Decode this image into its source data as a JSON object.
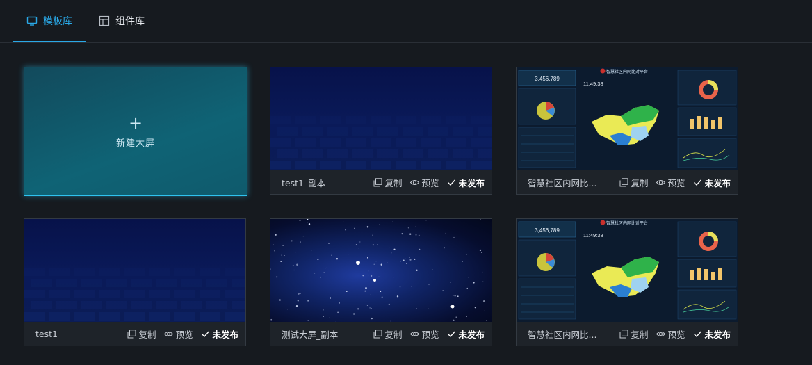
{
  "tabs": [
    {
      "label": "模板库",
      "active": true,
      "icon": "monitor-icon"
    },
    {
      "label": "组件库",
      "active": false,
      "icon": "layout-icon"
    }
  ],
  "new_card": {
    "plus": "+",
    "label": "新建大屏"
  },
  "actions": {
    "copy": "复制",
    "preview": "预览",
    "status": "未发布"
  },
  "cards": [
    {
      "name": "test1_副本",
      "thumb": "blue-grid"
    },
    {
      "name": "智慧社区内网比...",
      "thumb": "dashboard"
    },
    {
      "name": "test1",
      "thumb": "blue-grid"
    },
    {
      "name": "测试大屏_副本",
      "thumb": "starfield"
    },
    {
      "name": "智慧社区内网比...",
      "thumb": "dashboard"
    }
  ],
  "dashboard_thumb": {
    "title": "智慧社区内网比对平台",
    "big_number": "3,456,789",
    "clock": "11:49:38"
  },
  "colors": {
    "accent": "#2aa8e6",
    "background": "#161a1f",
    "card": "#1e2329"
  }
}
